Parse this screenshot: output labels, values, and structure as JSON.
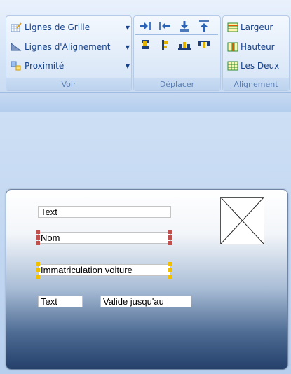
{
  "ribbon": {
    "voir": {
      "label": "Voir",
      "items": [
        {
          "label": "Lignes de Grille",
          "icon": "grid-lines-icon"
        },
        {
          "label": "Lignes d'Alignement",
          "icon": "alignment-lines-icon"
        },
        {
          "label": "Proximité",
          "icon": "proximity-icon"
        }
      ]
    },
    "deplacer": {
      "label": "Déplacer",
      "buttons": [
        "move-right-icon",
        "move-left-icon",
        "move-down-icon",
        "move-up-icon",
        "align-left-edges-icon",
        "align-right-edges-icon",
        "align-bottom-icon",
        "align-top-icon"
      ]
    },
    "alignement": {
      "label": "Alignement",
      "items": [
        {
          "label": "Largeur",
          "icon": "same-width-icon"
        },
        {
          "label": "Hauteur",
          "icon": "same-height-icon"
        },
        {
          "label": "Les Deux",
          "icon": "same-size-icon"
        }
      ]
    }
  },
  "form": {
    "fields": {
      "text1": "Text",
      "nom": "Nom",
      "immatriculation": "Immatriculation voiture",
      "text2": "Text",
      "valide": "Valide jusqu'au"
    }
  },
  "colors": {
    "accent": "#15428b",
    "handle_red": "#c0504d",
    "handle_yellow": "#f0c000"
  }
}
